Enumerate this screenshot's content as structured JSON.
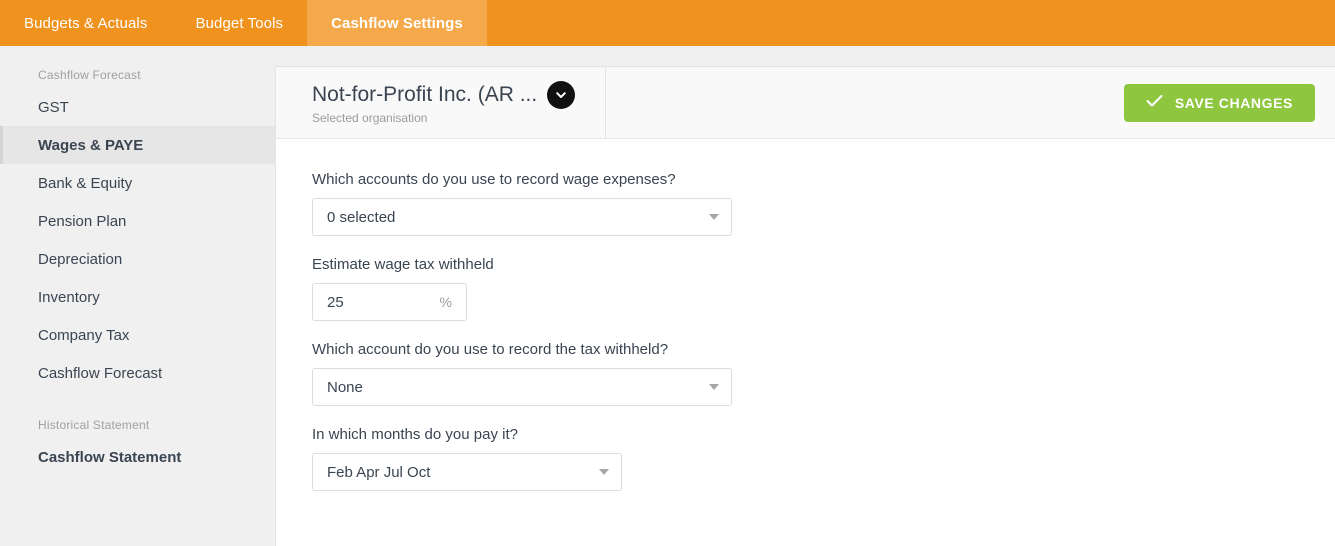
{
  "topnav": {
    "tabs": [
      {
        "label": "Budgets & Actuals",
        "active": false
      },
      {
        "label": "Budget Tools",
        "active": false
      },
      {
        "label": "Cashflow Settings",
        "active": true
      }
    ],
    "background_color": "#f0921e",
    "active_color": "#f5a94a"
  },
  "sidebar": {
    "groups": [
      {
        "title": "Cashflow Forecast",
        "items": [
          {
            "label": "GST",
            "selected": false
          },
          {
            "label": "Wages & PAYE",
            "selected": true
          },
          {
            "label": "Bank & Equity",
            "selected": false
          },
          {
            "label": "Pension Plan",
            "selected": false
          },
          {
            "label": "Depreciation",
            "selected": false
          },
          {
            "label": "Inventory",
            "selected": false
          },
          {
            "label": "Company Tax",
            "selected": false
          },
          {
            "label": "Cashflow Forecast",
            "selected": false
          }
        ]
      },
      {
        "title": "Historical Statement",
        "items": [
          {
            "label": "Cashflow Statement",
            "selected": false,
            "strong": true
          }
        ]
      }
    ]
  },
  "header": {
    "org_name": "Not-for-Profit Inc. (AR ...",
    "org_subtitle": "Selected organisation",
    "chevron_icon": "chevron-down-icon",
    "save_label": "SAVE CHANGES",
    "save_icon": "check-icon",
    "save_color": "#8ec640"
  },
  "form": {
    "fields": [
      {
        "label": "Which accounts do you use to record wage expenses?",
        "type": "select",
        "value": "0 selected",
        "width": "wide",
        "name": "wage-expense-accounts"
      },
      {
        "label": "Estimate wage tax withheld",
        "type": "number",
        "value": "25",
        "unit": "%",
        "name": "wage-tax-withheld"
      },
      {
        "label": "Which account do you use to record the tax withheld?",
        "type": "select",
        "value": "None",
        "width": "wide",
        "name": "tax-withheld-account"
      },
      {
        "label": "In which months do you pay it?",
        "type": "select",
        "value": "Feb Apr Jul Oct",
        "width": "narrow",
        "name": "payment-months"
      }
    ]
  }
}
